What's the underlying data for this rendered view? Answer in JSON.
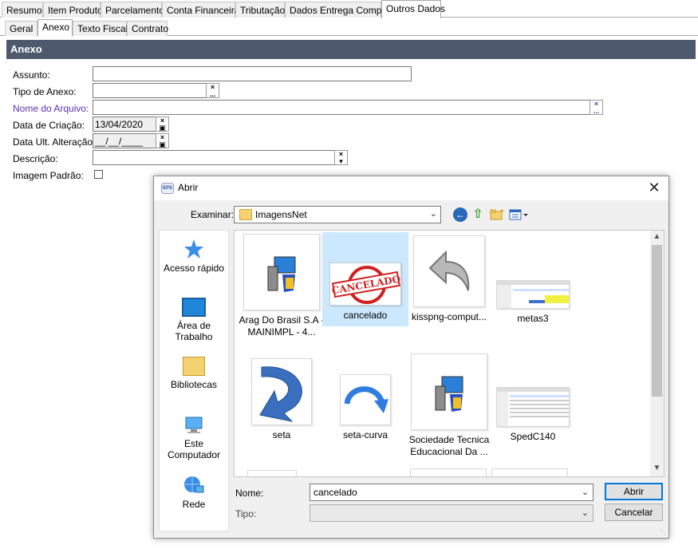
{
  "main_tabs": [
    "Resumo",
    "Item Produto",
    "Parcelamento",
    "Conta Financeira",
    "Tributação",
    "Dados Entrega Compra",
    "Outros Dados"
  ],
  "sub_tabs": [
    "Geral",
    "Anexo",
    "Texto Fiscal",
    "Contrato"
  ],
  "section_title": "Anexo",
  "form": {
    "assunto_label": "Assunto:",
    "tipo_anexo_label": "Tipo de Anexo:",
    "nome_arquivo_label": "Nome do Arquivo:",
    "data_criacao_label": "Data de Criação:",
    "data_criacao_value": "13/04/2020",
    "data_alteracao_label": "Data Ult. Alteração:",
    "data_alteracao_value": "__/__/____",
    "descricao_label": "Descrição:",
    "imagem_padrao_label": "Imagem Padrão:",
    "btn_clear": "×",
    "btn_more": "...",
    "btn_calendar": "▣",
    "btn_dropdown": "▾"
  },
  "dialog": {
    "app_icon": "EPS",
    "title": "Abrir",
    "close": "✕",
    "lookin_label": "Examinar:",
    "lookin_value": "ImagensNet",
    "places": [
      "Acesso rápido",
      "Área de Trabalho",
      "Bibliotecas",
      "Este Computador",
      "Rede"
    ],
    "files": [
      {
        "name": "Arag Do Brasil S.A - MAINIMPL - 4...",
        "icon": "installer-icon"
      },
      {
        "name": "cancelado",
        "icon": "cancelado-stamp",
        "selected": true,
        "stamp_text": "CANCELADO"
      },
      {
        "name": "kisspng-comput...",
        "icon": "back-arrow-image"
      },
      {
        "name": "metas3",
        "icon": "screenshot-thumb"
      },
      {
        "name": "seta",
        "icon": "curved-arrow-image"
      },
      {
        "name": "seta-curva",
        "icon": "curve-arrow-image"
      },
      {
        "name": "Sociedade Tecnica Educacional Da ...",
        "icon": "installer-icon"
      },
      {
        "name": "SpedC140",
        "icon": "screenshot-thumb"
      }
    ],
    "nome_label": "Nome:",
    "nome_value": "cancelado",
    "tipo_label": "Tipo:",
    "open_button": "Abrir",
    "cancel_button": "Cancelar"
  },
  "colors": {
    "section_header": "#4d5a6e",
    "selected": "#cce8ff",
    "purple_label": "#5a32b4"
  }
}
